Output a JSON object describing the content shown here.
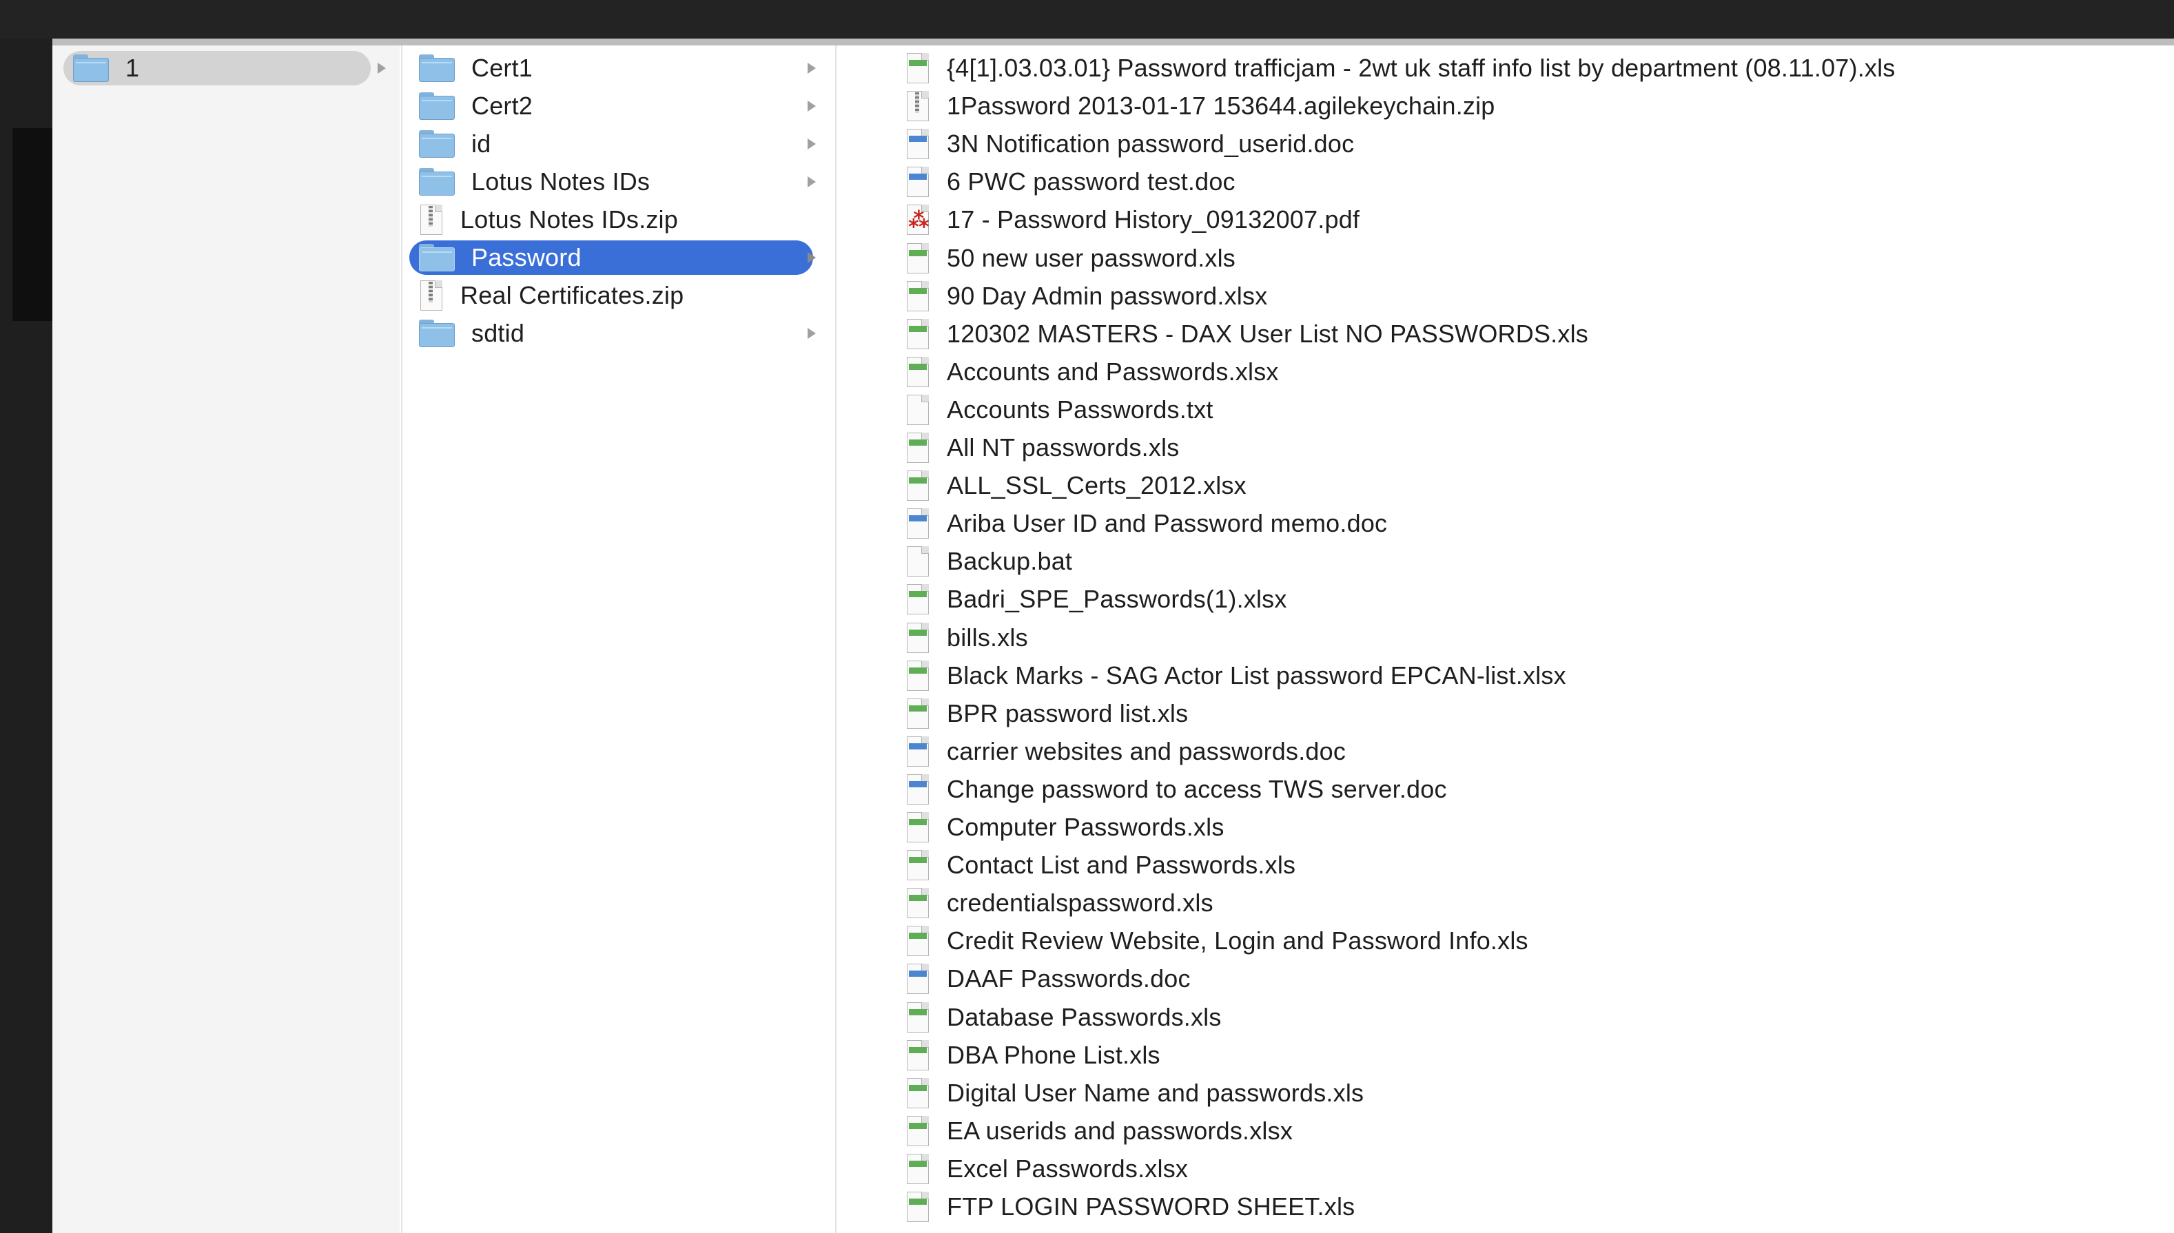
{
  "colors": {
    "selection": "#3a6fd8",
    "folder": "#8fc0e8",
    "xls_band": "#5fae56",
    "doc_band": "#4c86d1",
    "pdf": "#c7251f"
  },
  "column1": {
    "items": [
      {
        "label": "1",
        "icon": "folder-icon"
      }
    ]
  },
  "column2": {
    "items": [
      {
        "label": "Cert1",
        "icon": "folder-icon",
        "has_children": true
      },
      {
        "label": "Cert2",
        "icon": "folder-icon",
        "has_children": true
      },
      {
        "label": "id",
        "icon": "folder-icon",
        "has_children": true
      },
      {
        "label": "Lotus Notes IDs",
        "icon": "folder-icon",
        "has_children": true
      },
      {
        "label": "Lotus Notes IDs.zip",
        "icon": "zip-file-icon",
        "has_children": false
      },
      {
        "label": "Password",
        "icon": "folder-icon",
        "has_children": true,
        "selected": true
      },
      {
        "label": "Real Certificates.zip",
        "icon": "zip-file-icon",
        "has_children": false
      },
      {
        "label": "sdtid",
        "icon": "folder-icon",
        "has_children": true
      }
    ]
  },
  "column3": {
    "items": [
      {
        "label": "{4[1].03.03.01} Password trafficjam - 2wt uk staff info list by department (08.11.07).xls",
        "icon": "spreadsheet-file-icon"
      },
      {
        "label": "1Password 2013-01-17 153644.agilekeychain.zip",
        "icon": "zip-file-icon"
      },
      {
        "label": "3N Notification password_userid.doc",
        "icon": "word-doc-icon"
      },
      {
        "label": "6 PWC password test.doc",
        "icon": "word-doc-icon"
      },
      {
        "label": "17 - Password History_09132007.pdf",
        "icon": "pdf-file-icon"
      },
      {
        "label": "50 new user password.xls",
        "icon": "spreadsheet-file-icon"
      },
      {
        "label": "90 Day Admin password.xlsx",
        "icon": "spreadsheet-file-icon"
      },
      {
        "label": "120302 MASTERS - DAX User List NO PASSWORDS.xls",
        "icon": "spreadsheet-file-icon"
      },
      {
        "label": "Accounts and Passwords.xlsx",
        "icon": "spreadsheet-file-icon"
      },
      {
        "label": "Accounts Passwords.txt",
        "icon": "text-file-icon"
      },
      {
        "label": "All NT passwords.xls",
        "icon": "spreadsheet-file-icon"
      },
      {
        "label": "ALL_SSL_Certs_2012.xlsx",
        "icon": "spreadsheet-file-icon"
      },
      {
        "label": "Ariba User ID and Password memo.doc",
        "icon": "word-doc-icon"
      },
      {
        "label": "Backup.bat",
        "icon": "text-file-icon"
      },
      {
        "label": "Badri_SPE_Passwords(1).xlsx",
        "icon": "spreadsheet-file-icon"
      },
      {
        "label": "bills.xls",
        "icon": "spreadsheet-file-icon"
      },
      {
        "label": "Black Marks - SAG Actor List password EPCAN-list.xlsx",
        "icon": "spreadsheet-file-icon"
      },
      {
        "label": "BPR password list.xls",
        "icon": "spreadsheet-file-icon"
      },
      {
        "label": "carrier websites and passwords.doc",
        "icon": "word-doc-icon"
      },
      {
        "label": "Change password to access TWS server.doc",
        "icon": "word-doc-icon"
      },
      {
        "label": "Computer Passwords.xls",
        "icon": "spreadsheet-file-icon"
      },
      {
        "label": "Contact List and Passwords.xls",
        "icon": "spreadsheet-file-icon"
      },
      {
        "label": "credentialspassword.xls",
        "icon": "spreadsheet-file-icon"
      },
      {
        "label": "Credit Review Website, Login and Password Info.xls",
        "icon": "spreadsheet-file-icon"
      },
      {
        "label": "DAAF Passwords.doc",
        "icon": "word-doc-icon"
      },
      {
        "label": "Database Passwords.xls",
        "icon": "spreadsheet-file-icon"
      },
      {
        "label": "DBA Phone List.xls",
        "icon": "spreadsheet-file-icon"
      },
      {
        "label": "Digital User Name and passwords.xls",
        "icon": "spreadsheet-file-icon"
      },
      {
        "label": "EA userids and passwords.xlsx",
        "icon": "spreadsheet-file-icon"
      },
      {
        "label": "Excel Passwords.xlsx",
        "icon": "spreadsheet-file-icon"
      },
      {
        "label": "FTP LOGIN PASSWORD SHEET.xls",
        "icon": "spreadsheet-file-icon"
      }
    ]
  }
}
